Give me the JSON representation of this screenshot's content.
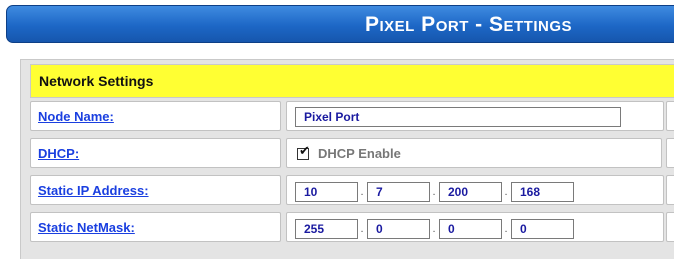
{
  "header": {
    "title": "Pixel Port - Settings"
  },
  "section": {
    "title": "Network Settings"
  },
  "rows": {
    "node_name": {
      "label": "Node Name:",
      "value": "Pixel Port"
    },
    "dhcp": {
      "label": "DHCP:",
      "checkbox_label": "DHCP Enable",
      "checked": true
    },
    "static_ip": {
      "label": "Static IP Address:",
      "octets": [
        "10",
        "7",
        "200",
        "168"
      ]
    },
    "static_netmask": {
      "label": "Static NetMask:",
      "octets": [
        "255",
        "0",
        "0",
        "0"
      ]
    }
  },
  "colors": {
    "header_blue": "#1d67c6",
    "section_yellow": "#ffff33",
    "link_blue": "#1a3fe0"
  },
  "icons": {
    "checkbox": "checkmark-icon"
  }
}
